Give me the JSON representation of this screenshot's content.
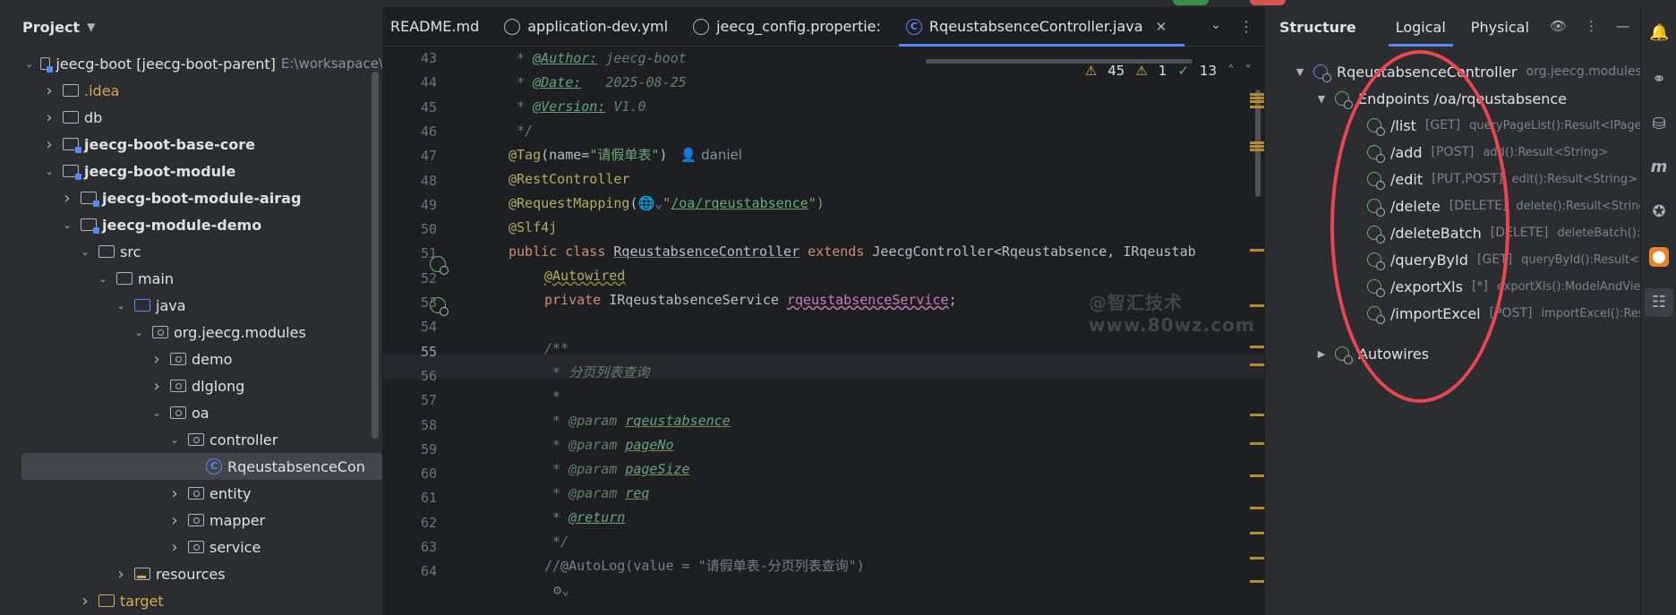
{
  "project": {
    "title": "Project",
    "tree": [
      {
        "label": "jeecg-boot [jeecg-boot-parent]",
        "extra": "E:\\worksapace\\",
        "indent": 0,
        "arrow": "down",
        "icon": "module",
        "bold": false
      },
      {
        "label": ".idea",
        "indent": 1,
        "arrow": "right",
        "icon": "folder",
        "color": "orange"
      },
      {
        "label": "db",
        "indent": 1,
        "arrow": "right",
        "icon": "folder"
      },
      {
        "label": "jeecg-boot-base-core",
        "indent": 1,
        "arrow": "right",
        "icon": "module",
        "bold": true
      },
      {
        "label": "jeecg-boot-module",
        "indent": 1,
        "arrow": "down",
        "icon": "module",
        "bold": true
      },
      {
        "label": "jeecg-boot-module-airag",
        "indent": 2,
        "arrow": "right",
        "icon": "module",
        "bold": true
      },
      {
        "label": "jeecg-module-demo",
        "indent": 2,
        "arrow": "down",
        "icon": "module",
        "bold": true
      },
      {
        "label": "src",
        "indent": 3,
        "arrow": "down",
        "icon": "folder"
      },
      {
        "label": "main",
        "indent": 4,
        "arrow": "down",
        "icon": "folder"
      },
      {
        "label": "java",
        "indent": 5,
        "arrow": "down",
        "icon": "src"
      },
      {
        "label": "org.jeecg.modules",
        "indent": 6,
        "arrow": "down",
        "icon": "pkg"
      },
      {
        "label": "demo",
        "indent": 7,
        "arrow": "right",
        "icon": "pkg"
      },
      {
        "label": "dlglong",
        "indent": 7,
        "arrow": "right",
        "icon": "pkg"
      },
      {
        "label": "oa",
        "indent": 7,
        "arrow": "down",
        "icon": "pkg"
      },
      {
        "label": "controller",
        "indent": 8,
        "arrow": "down",
        "icon": "pkg"
      },
      {
        "label": "RqeustabsenceCon",
        "indent": 9,
        "arrow": "none",
        "icon": "class",
        "selected": true
      },
      {
        "label": "entity",
        "indent": 8,
        "arrow": "right",
        "icon": "pkg"
      },
      {
        "label": "mapper",
        "indent": 8,
        "arrow": "right",
        "icon": "pkg"
      },
      {
        "label": "service",
        "indent": 8,
        "arrow": "right",
        "icon": "pkg"
      },
      {
        "label": "resources",
        "indent": 5,
        "arrow": "right",
        "icon": "res"
      },
      {
        "label": "target",
        "indent": 3,
        "arrow": "right",
        "icon": "tgt",
        "color": "orange"
      }
    ]
  },
  "editor": {
    "tabs": [
      {
        "label": "README.md",
        "icon": "none"
      },
      {
        "label": "application-dev.yml",
        "icon": "yml"
      },
      {
        "label": "jeecg_config.propertie:",
        "icon": "gear"
      },
      {
        "label": "RqeustabsenceController.java",
        "icon": "java",
        "active": true
      }
    ],
    "inspections": {
      "warnings": "45",
      "weak": "1",
      "ok": "13"
    },
    "line_numbers": [
      "43",
      "44",
      "45",
      "46",
      "47",
      "48",
      "49",
      "50",
      "51",
      "52",
      "53",
      "54",
      "55",
      "56",
      "57",
      "58",
      "59",
      "60",
      "61",
      "62",
      "63",
      "64"
    ],
    "code": {
      "l43a": " * ",
      "l43b": "@Author:",
      "l43c": " jeecg-boot",
      "l44a": " * ",
      "l44b": "@Date:",
      "l44c": "   2025-08-25",
      "l45a": " * ",
      "l45b": "@Version:",
      "l45c": " V1.0",
      "l46": " */",
      "l47a": "@Tag",
      "l47b": "(name=",
      "l47c": "\"请假单表\"",
      "l47d": ")",
      "l47e": "daniel",
      "l48": "@RestController",
      "l49a": "@RequestMapping",
      "l49b": "(",
      "l49c": "\"",
      "l49d": "/oa/rqeustabsence",
      "l49e": "\")",
      "l50": "@Slf4j",
      "l51a": "public class ",
      "l51b": "RqeustabsenceController",
      "l51c": " extends ",
      "l51d": "JeecgController<Rqeustabsence, IRqeustab",
      "l52": "@Autowired",
      "l53a": "private ",
      "l53b": "IRqeustabsenceService ",
      "l53c": "rqeustabsenceService",
      "l53d": ";",
      "l55": "/**",
      "l56": " * 分页列表查询",
      "l57": " *",
      "l58a": " * ",
      "l58b": "@param",
      "l58c": "rqeustabsence",
      "l59a": " * ",
      "l59b": "@param",
      "l59c": "pageNo",
      "l60a": " * ",
      "l60b": "@param",
      "l60c": "pageSize",
      "l61a": " * ",
      "l61b": "@param",
      "l61c": "req",
      "l62a": " * ",
      "l62b": "@return",
      "l63": " */",
      "l64": "//@AutoLog(value = \"请假单表-分页列表查询\")"
    },
    "watermark": "@智汇技术  www.80wz.com"
  },
  "structure": {
    "title": "Structure",
    "tabs": [
      "Logical",
      "Physical"
    ],
    "root": {
      "label": "RqeustabsenceController",
      "pkg": "org.jeecg.modules.c"
    },
    "endpoints_label": "Endpoints /oa/rqeustabsence",
    "endpoints": [
      {
        "path": "/list",
        "verb": "[GET]",
        "method": "queryPageList():Result<IPage<Rqe"
      },
      {
        "path": "/add",
        "verb": "[POST]",
        "method": "add():Result<String>"
      },
      {
        "path": "/edit",
        "verb": "[PUT,POST]",
        "method": "edit():Result<String>"
      },
      {
        "path": "/delete",
        "verb": "[DELETE]",
        "method": "delete():Result<String>"
      },
      {
        "path": "/deleteBatch",
        "verb": "[DELETE]",
        "method": "deleteBatch():Result"
      },
      {
        "path": "/queryById",
        "verb": "[GET]",
        "method": "queryById():Result<Rqeus"
      },
      {
        "path": "/exportXls",
        "verb": "[*]",
        "method": "exportXls():ModelAndView"
      },
      {
        "path": "/importExcel",
        "verb": "[POST]",
        "method": "importExcel():Result<"
      }
    ],
    "autowires_label": "Autowires"
  },
  "colors": {
    "accent": "#548af7",
    "highlight_ring": "#e8474f",
    "endpoint_icon": "#5fb865"
  }
}
